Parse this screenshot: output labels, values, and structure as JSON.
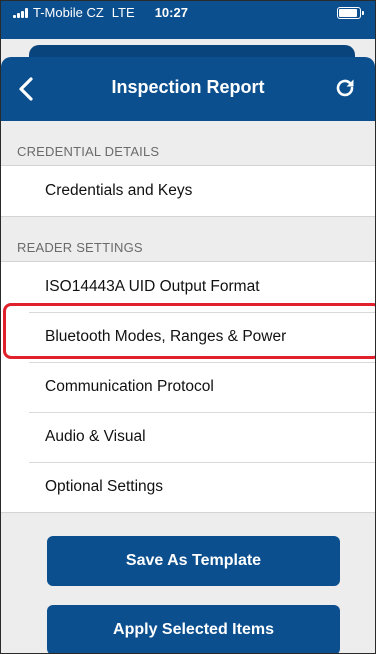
{
  "status_bar": {
    "carrier": "T-Mobile CZ",
    "network": "LTE",
    "time": "10:27"
  },
  "nav": {
    "title": "Inspection Report",
    "back_icon": "chevron-left-icon",
    "refresh_icon": "refresh-icon"
  },
  "sections": [
    {
      "header": "CREDENTIAL DETAILS",
      "items": [
        {
          "label": "Credentials and Keys"
        }
      ]
    },
    {
      "header": "READER SETTINGS",
      "items": [
        {
          "label": "ISO14443A UID Output Format"
        },
        {
          "label": "Bluetooth Modes, Ranges & Power",
          "highlighted": true
        },
        {
          "label": "Communication Protocol"
        },
        {
          "label": "Audio & Visual"
        },
        {
          "label": "Optional Settings"
        }
      ]
    }
  ],
  "buttons": {
    "save_template": "Save As Template",
    "apply_selected": "Apply Selected Items"
  },
  "colors": {
    "primary": "#0b4f8f",
    "highlight": "#e0202a",
    "background": "#ededed"
  }
}
